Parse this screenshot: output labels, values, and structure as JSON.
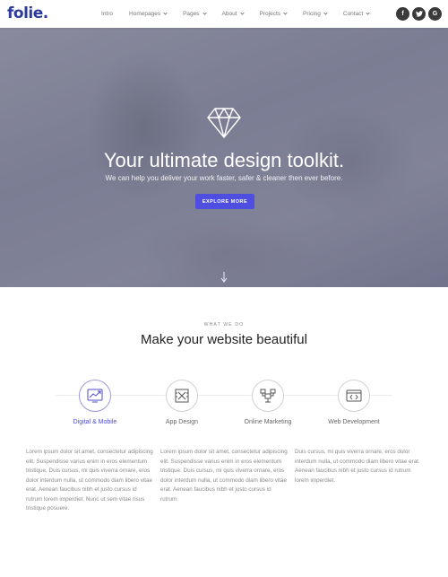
{
  "header": {
    "logo": "folie.",
    "nav": [
      {
        "label": "Intro",
        "has_dropdown": false
      },
      {
        "label": "Homepages",
        "has_dropdown": true
      },
      {
        "label": "Pages",
        "has_dropdown": true
      },
      {
        "label": "About",
        "has_dropdown": true
      },
      {
        "label": "Projects",
        "has_dropdown": true
      },
      {
        "label": "Pricing",
        "has_dropdown": true
      },
      {
        "label": "Contact",
        "has_dropdown": true
      }
    ],
    "socials": [
      {
        "icon": "facebook-icon",
        "glyph": "f"
      },
      {
        "icon": "twitter-icon",
        "glyph": "t"
      },
      {
        "icon": "google-icon",
        "glyph": "G"
      }
    ]
  },
  "hero": {
    "icon": "diamond-icon",
    "title": "Your ultimate design toolkit.",
    "subtitle": "We can help you deliver your work faster, safer & cleaner then ever before.",
    "cta_label": "EXPLORE MORE",
    "scroll_icon": "arrow-down-icon"
  },
  "section": {
    "eyebrow": "WHAT WE DO",
    "title": "Make your website beautiful",
    "features": [
      {
        "label": "Digital & Mobile",
        "icon": "chart-icon",
        "active": true
      },
      {
        "label": "App Design",
        "icon": "app-design-icon",
        "active": false
      },
      {
        "label": "Online Marketing",
        "icon": "marketing-icon",
        "active": false
      },
      {
        "label": "Web Development",
        "icon": "code-icon",
        "active": false
      }
    ],
    "paragraphs": [
      "Lorem ipsum dolor sit amet, consectetur adipiscing elit. Suspendisse varius enim in eros elementum tristique. Duis cursus, mi quis viverra ornare, eros dolor interdum nulla, ut commodo diam libero vitae erat. Aenean faucibus nibh et justo cursus id rutrum lorem imperdiet. Nunc ut sem vitae risus tristique posuere.",
      "Lorem ipsum dolor sit amet, consectetur adipiscing elit. Suspendisse varius enim in eros elementum tristique. Duis cursus, mi quis viverra ornare, eros dolor interdum nulla, ut commodo diam libero vitae erat. Aenean faucibus nibh et justo cursus id rutrum.",
      "Duis cursus, mi quis viverra ornare, eros dolor interdum nulla, ut commodo diam libero vitae erat. Aenean faucibus nibh et justo cursus id rutrum lorem imperdiet."
    ]
  },
  "colors": {
    "brand": "#2e3a9c",
    "accent": "#4e4ee0"
  }
}
